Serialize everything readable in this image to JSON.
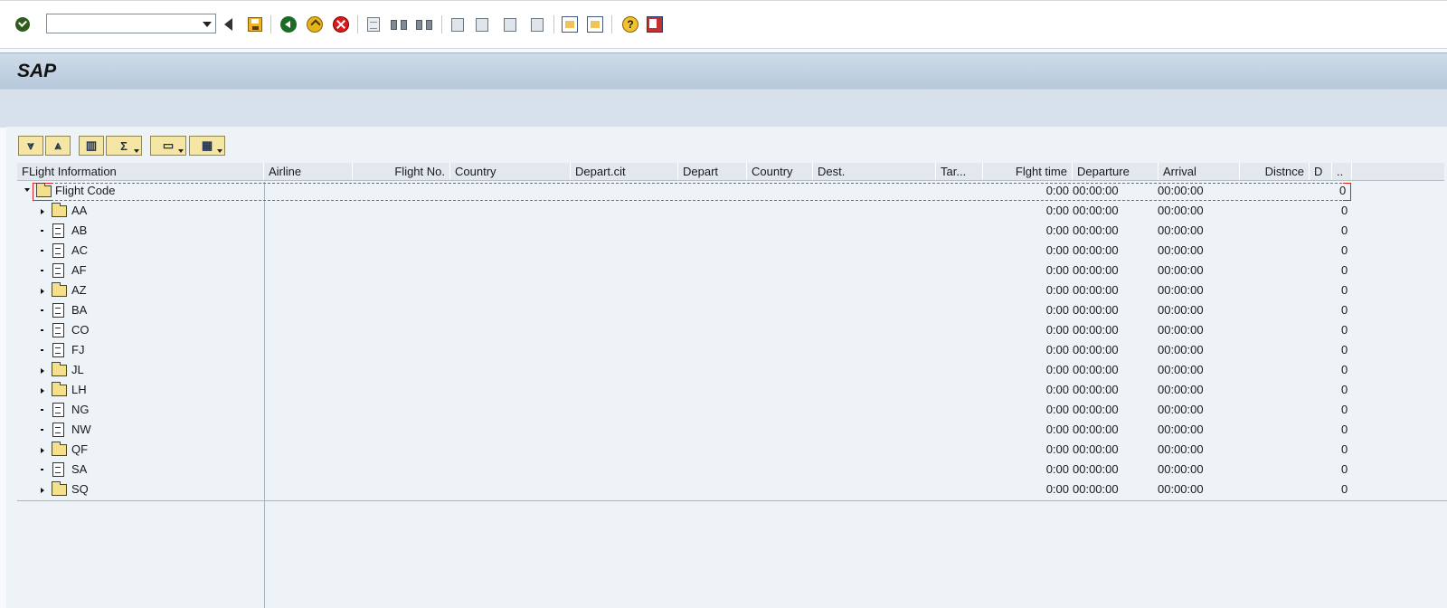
{
  "toolbar": {
    "command_field": "",
    "icons": [
      "enter-icon",
      "command-field-dropdown-icon",
      "back-icon",
      "save-icon",
      "back-green-icon",
      "exit-icon",
      "cancel-icon",
      "print-icon",
      "find-icon",
      "find-next-icon",
      "first-page-icon",
      "previous-page-icon",
      "next-page-icon",
      "last-page-icon",
      "create-session-icon",
      "shortcut-icon",
      "help-icon",
      "layout-menu-icon"
    ]
  },
  "header": {
    "title": "SAP"
  },
  "alv_toolbar": {
    "buttons": [
      "expand-icon",
      "collapse-icon",
      "find-icon",
      "sum-icon",
      "print-icon",
      "layout-icon"
    ]
  },
  "columns": [
    {
      "label": "FLight Information"
    },
    {
      "label": "Airline"
    },
    {
      "label": "Flight No."
    },
    {
      "label": "Country"
    },
    {
      "label": "Depart.cit"
    },
    {
      "label": "Depart"
    },
    {
      "label": "Country"
    },
    {
      "label": "Dest."
    },
    {
      "label": "Tar..."
    },
    {
      "label": "Flght time"
    },
    {
      "label": "Departure"
    },
    {
      "label": "Arrival"
    },
    {
      "label": "Distnce"
    },
    {
      "label": "D"
    },
    {
      "label": ".."
    }
  ],
  "root": {
    "label": "Flight Code",
    "flight_time": "0:00",
    "departure": "00:00:00",
    "arrival": "00:00:00",
    "last": "0"
  },
  "rows": [
    {
      "code": "AA",
      "kind": "folder",
      "flight_time": "0:00",
      "departure": "00:00:00",
      "arrival": "00:00:00",
      "last": "0"
    },
    {
      "code": "AB",
      "kind": "doc",
      "flight_time": "0:00",
      "departure": "00:00:00",
      "arrival": "00:00:00",
      "last": "0"
    },
    {
      "code": "AC",
      "kind": "doc",
      "flight_time": "0:00",
      "departure": "00:00:00",
      "arrival": "00:00:00",
      "last": "0"
    },
    {
      "code": "AF",
      "kind": "doc",
      "flight_time": "0:00",
      "departure": "00:00:00",
      "arrival": "00:00:00",
      "last": "0"
    },
    {
      "code": "AZ",
      "kind": "folder",
      "flight_time": "0:00",
      "departure": "00:00:00",
      "arrival": "00:00:00",
      "last": "0"
    },
    {
      "code": "BA",
      "kind": "doc",
      "flight_time": "0:00",
      "departure": "00:00:00",
      "arrival": "00:00:00",
      "last": "0"
    },
    {
      "code": "CO",
      "kind": "doc",
      "flight_time": "0:00",
      "departure": "00:00:00",
      "arrival": "00:00:00",
      "last": "0"
    },
    {
      "code": "FJ",
      "kind": "doc",
      "flight_time": "0:00",
      "departure": "00:00:00",
      "arrival": "00:00:00",
      "last": "0"
    },
    {
      "code": "JL",
      "kind": "folder",
      "flight_time": "0:00",
      "departure": "00:00:00",
      "arrival": "00:00:00",
      "last": "0"
    },
    {
      "code": "LH",
      "kind": "folder",
      "flight_time": "0:00",
      "departure": "00:00:00",
      "arrival": "00:00:00",
      "last": "0"
    },
    {
      "code": "NG",
      "kind": "doc",
      "flight_time": "0:00",
      "departure": "00:00:00",
      "arrival": "00:00:00",
      "last": "0"
    },
    {
      "code": "NW",
      "kind": "doc",
      "flight_time": "0:00",
      "departure": "00:00:00",
      "arrival": "00:00:00",
      "last": "0"
    },
    {
      "code": "QF",
      "kind": "folder",
      "flight_time": "0:00",
      "departure": "00:00:00",
      "arrival": "00:00:00",
      "last": "0"
    },
    {
      "code": "SA",
      "kind": "doc",
      "flight_time": "0:00",
      "departure": "00:00:00",
      "arrival": "00:00:00",
      "last": "0"
    },
    {
      "code": "SQ",
      "kind": "folder",
      "flight_time": "0:00",
      "departure": "00:00:00",
      "arrival": "00:00:00",
      "last": "0"
    }
  ]
}
